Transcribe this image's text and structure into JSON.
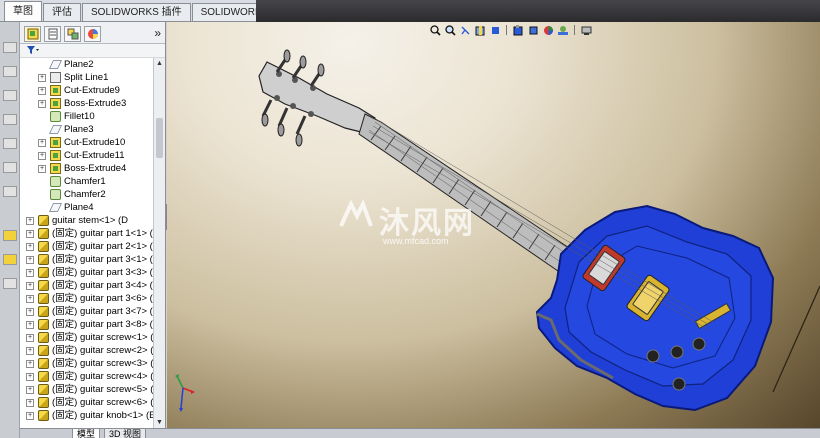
{
  "top_tabs": [
    {
      "label": "草图",
      "active": true
    },
    {
      "label": "评估",
      "active": false
    },
    {
      "label": "SOLIDWORKS 插件",
      "active": false
    },
    {
      "label": "SOLIDWORKS MBD",
      "active": false
    }
  ],
  "panel": {
    "tabs": [
      "feature-manager-icon",
      "property-manager-icon",
      "configuration-manager-icon",
      "display-manager-icon"
    ],
    "collapse_glyph": "»",
    "filter_icon": "filter-icon"
  },
  "tree_items": [
    {
      "label": "Plane2",
      "icon": "plane",
      "indent": 1,
      "expander": false
    },
    {
      "label": "Split Line1",
      "icon": "split",
      "indent": 1,
      "expander": true
    },
    {
      "label": "Cut-Extrude9",
      "icon": "feat",
      "indent": 1,
      "expander": true
    },
    {
      "label": "Boss-Extrude3",
      "icon": "feat",
      "indent": 1,
      "expander": true
    },
    {
      "label": "Fillet10",
      "icon": "fillet",
      "indent": 1,
      "expander": false
    },
    {
      "label": "Plane3",
      "icon": "plane",
      "indent": 1,
      "expander": false
    },
    {
      "label": "Cut-Extrude10",
      "icon": "feat",
      "indent": 1,
      "expander": true
    },
    {
      "label": "Cut-Extrude11",
      "icon": "feat",
      "indent": 1,
      "expander": true
    },
    {
      "label": "Boss-Extrude4",
      "icon": "feat",
      "indent": 1,
      "expander": true
    },
    {
      "label": "Chamfer1",
      "icon": "fillet",
      "indent": 1,
      "expander": false
    },
    {
      "label": "Chamfer2",
      "icon": "fillet",
      "indent": 1,
      "expander": false
    },
    {
      "label": "Plane4",
      "icon": "plane",
      "indent": 1,
      "expander": false
    },
    {
      "label": "guitar stem<1> (D",
      "icon": "part",
      "indent": 0,
      "expander": true
    },
    {
      "label": "(固定) guitar part 1<1> (",
      "icon": "part",
      "indent": 0,
      "expander": true
    },
    {
      "label": "(固定) guitar part 2<1> (",
      "icon": "part",
      "indent": 0,
      "expander": true
    },
    {
      "label": "(固定) guitar part 3<1> (",
      "icon": "part",
      "indent": 0,
      "expander": true
    },
    {
      "label": "(固定) guitar part 3<3> (",
      "icon": "part",
      "indent": 0,
      "expander": true
    },
    {
      "label": "(固定) guitar part 3<4> (",
      "icon": "part",
      "indent": 0,
      "expander": true
    },
    {
      "label": "(固定) guitar part 3<6> (",
      "icon": "part",
      "indent": 0,
      "expander": true
    },
    {
      "label": "(固定) guitar part 3<7> (",
      "icon": "part",
      "indent": 0,
      "expander": true
    },
    {
      "label": "(固定) guitar part 3<8> (",
      "icon": "part",
      "indent": 0,
      "expander": true
    },
    {
      "label": "(固定) guitar screw<1> (I",
      "icon": "part",
      "indent": 0,
      "expander": true
    },
    {
      "label": "(固定) guitar screw<2> (I",
      "icon": "part",
      "indent": 0,
      "expander": true
    },
    {
      "label": "(固定) guitar screw<3> (I",
      "icon": "part",
      "indent": 0,
      "expander": true
    },
    {
      "label": "(固定) guitar screw<4> (I",
      "icon": "part",
      "indent": 0,
      "expander": true
    },
    {
      "label": "(固定) guitar screw<5> (I",
      "icon": "part",
      "indent": 0,
      "expander": true
    },
    {
      "label": "(固定) guitar screw<6> (I",
      "icon": "part",
      "indent": 0,
      "expander": true
    },
    {
      "label": "(固定) guitar knob<1> (E",
      "icon": "part",
      "indent": 0,
      "expander": true
    }
  ],
  "bottom_tabs": [
    {
      "label": "模型",
      "active": true
    },
    {
      "label": "3D 视图",
      "active": false
    }
  ],
  "heads_up_toolbar": [
    "zoom-to-fit-icon",
    "zoom-to-area-icon",
    "previous-view-icon",
    "section-view-icon",
    "view-orientation-icon",
    "display-style-icon",
    "hide-show-items-icon",
    "edit-appearance-icon",
    "apply-scene-icon",
    "view-settings-icon"
  ],
  "watermark": {
    "name": "沐风网",
    "url": "www.mfcad.com"
  },
  "colors": {
    "body_blue": "#1f3fd6",
    "body_outline": "#0a1a7a",
    "neck_gray": "#bdbdbd",
    "fret_dark": "#3a3a3a",
    "pickup_gold": "#d9b431",
    "pickup_red": "#c0392b"
  }
}
